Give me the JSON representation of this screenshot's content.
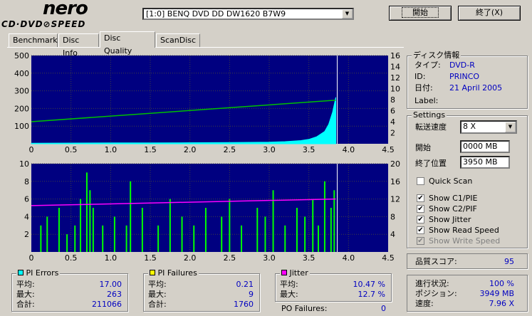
{
  "app": {
    "logo_main": "nero",
    "logo_sub": "CD·DVD⊘SPEED"
  },
  "drive": {
    "selected": "[1:0]   BENQ DVD DD DW1620 B7W9"
  },
  "buttons": {
    "start": "開始",
    "exit": "終了(X)"
  },
  "tabs": [
    {
      "label": "Benchmark"
    },
    {
      "label": "Disc Info"
    },
    {
      "label": "Disc Quality"
    },
    {
      "label": "ScanDisc"
    }
  ],
  "disc_info": {
    "title": "ディスク情報",
    "type_label": "タイプ:",
    "type_value": "DVD-R",
    "id_label": "ID:",
    "id_value": "PRINCO",
    "date_label": "日付:",
    "date_value": "21 April 2005",
    "label_label": "Label:",
    "label_value": ""
  },
  "settings": {
    "title": "Settings",
    "speed_label": "転送速度",
    "speed_value": "8 X",
    "start_label": "開始",
    "start_value": "0000 MB",
    "end_label": "終了位置",
    "end_value": "3950 MB",
    "quick_scan": "Quick Scan",
    "show_c1": "Show C1/PIE",
    "show_c2": "Show C2/PIF",
    "show_jitter": "Show Jitter",
    "show_read": "Show Read Speed",
    "show_write": "Show Write Speed"
  },
  "quality": {
    "label": "品質スコア:",
    "value": "95"
  },
  "progress": {
    "status_label": "進行状況:",
    "status_value": "100 %",
    "position_label": "ポジション:",
    "position_value": "3949 MB",
    "speed_label": "速度:",
    "speed_value": "7.96 X"
  },
  "pi_errors": {
    "title": "PI Errors",
    "color": "#00ffff",
    "avg_label": "平均:",
    "avg_value": "17.00",
    "max_label": "最大:",
    "max_value": "263",
    "total_label": "合計:",
    "total_value": "211066"
  },
  "pi_failures": {
    "title": "PI Failures",
    "color": "#ffff00",
    "avg_label": "平均:",
    "avg_value": "0.21",
    "max_label": "最大:",
    "max_value": "9",
    "total_label": "合計:",
    "total_value": "1760"
  },
  "jitter": {
    "title": "Jitter",
    "color": "#ff00ff",
    "avg_label": "平均:",
    "avg_value": "10.47 %",
    "max_label": "最大:",
    "max_value": "12.7 %"
  },
  "po_failures": {
    "label": "PO Failures:",
    "value": "0"
  },
  "chart_data": [
    {
      "type": "area",
      "name": "pi-errors-chart",
      "xlim": [
        0,
        4.5
      ],
      "ylim": [
        0,
        500
      ],
      "y2lim": [
        0,
        16
      ],
      "x_ticks": [
        "0",
        "0.5",
        "1.0",
        "1.5",
        "2.0",
        "2.5",
        "3.0",
        "3.5",
        "4.0",
        "4.5"
      ],
      "y_ticks": [
        "100",
        "200",
        "300",
        "400",
        "500"
      ],
      "y2_ticks": [
        "2",
        "4",
        "6",
        "8",
        "10",
        "12",
        "14",
        "16"
      ],
      "series": [
        {
          "color": "#00ffff",
          "x": [
            0,
            0.5,
            1.0,
            1.5,
            2.0,
            2.5,
            3.0,
            3.2,
            3.4,
            3.5,
            3.6,
            3.7,
            3.75,
            3.8,
            3.84
          ],
          "y": [
            3,
            4,
            5,
            5,
            6,
            7,
            9,
            12,
            18,
            25,
            40,
            70,
            110,
            180,
            263
          ]
        },
        {
          "color": "#00c000",
          "x": [
            0,
            3.84
          ],
          "y2": [
            4.0,
            7.9
          ]
        }
      ]
    },
    {
      "type": "bar",
      "name": "pi-failures-chart",
      "xlim": [
        0,
        4.5
      ],
      "ylim": [
        0,
        10
      ],
      "y2lim": [
        0,
        20
      ],
      "x_ticks": [
        "0",
        "0.5",
        "1.0",
        "1.5",
        "2.0",
        "2.5",
        "3.0",
        "3.5",
        "4.0",
        "4.5"
      ],
      "y_ticks": [
        "2",
        "4",
        "6",
        "8",
        "10"
      ],
      "y2_ticks": [
        "4",
        "8",
        "12",
        "16",
        "20"
      ],
      "series": [
        {
          "color": "#00ff00",
          "x": [
            0.12,
            0.2,
            0.35,
            0.45,
            0.55,
            0.62,
            0.7,
            0.74,
            0.78,
            0.9,
            1.05,
            1.2,
            1.25,
            1.4,
            1.6,
            1.75,
            1.9,
            2.05,
            2.2,
            2.4,
            2.5,
            2.65,
            2.85,
            2.95,
            3.05,
            3.2,
            3.35,
            3.45,
            3.55,
            3.62,
            3.7,
            3.78,
            3.82
          ],
          "y": [
            3,
            4,
            5,
            2,
            3,
            6,
            9,
            7,
            5,
            3,
            4,
            3,
            8,
            5,
            3,
            6,
            4,
            3,
            5,
            4,
            6,
            3,
            5,
            4,
            7,
            3,
            5,
            4,
            6,
            3,
            8,
            5,
            7
          ]
        },
        {
          "color": "#ff00ff",
          "x": [
            0,
            3.84
          ],
          "y2": [
            10.5,
            12.0
          ]
        }
      ]
    }
  ]
}
